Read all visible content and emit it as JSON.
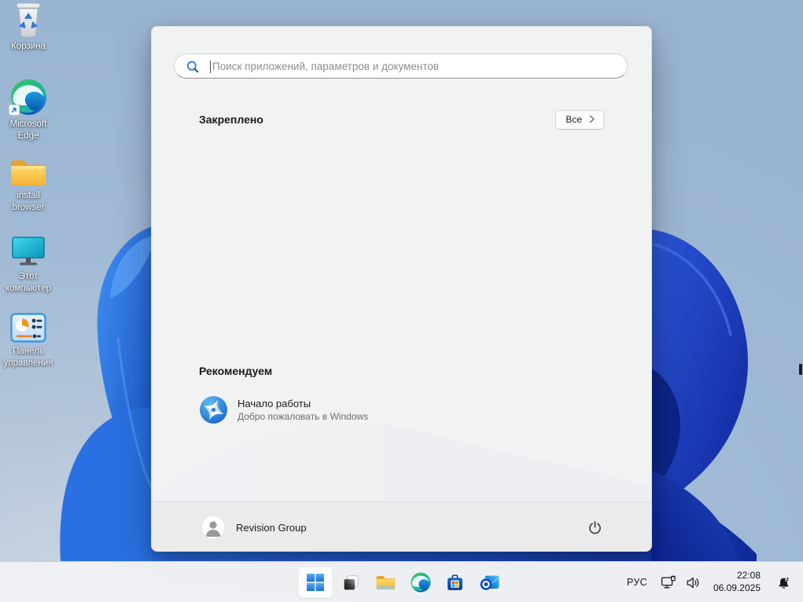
{
  "desktop": {
    "icons": [
      {
        "name": "recycle-bin",
        "label": "Корзина"
      },
      {
        "name": "microsoft-edge",
        "label": "Microsoft Edge"
      },
      {
        "name": "install-browser-folder",
        "label": "install browser"
      },
      {
        "name": "this-pc",
        "label": "Этот компьютер"
      },
      {
        "name": "control-panel",
        "label": "Панель управления"
      }
    ]
  },
  "start_menu": {
    "search": {
      "placeholder": "Поиск приложений, параметров и документов"
    },
    "pinned": {
      "title": "Закреплено",
      "all_button": "Все"
    },
    "recommended": {
      "title": "Рекомендуем",
      "items": [
        {
          "title": "Начало работы",
          "subtitle": "Добро пожаловать в Windows"
        }
      ]
    },
    "footer": {
      "user_name": "Revision Group"
    }
  },
  "taskbar": {
    "buttons": [
      {
        "name": "start"
      },
      {
        "name": "task-view"
      },
      {
        "name": "file-explorer"
      },
      {
        "name": "edge"
      },
      {
        "name": "microsoft-store"
      },
      {
        "name": "outlook"
      }
    ],
    "tray": {
      "language": "РУС",
      "time": "22:08",
      "date": "06.09.2025"
    }
  },
  "colors": {
    "accent": "#0a6cd6",
    "menu_bg": "#f3f3f3",
    "taskbar_bg": "#eff1f4",
    "bloom_bright": "#2e7ce6",
    "bloom_dark": "#132f9d"
  }
}
